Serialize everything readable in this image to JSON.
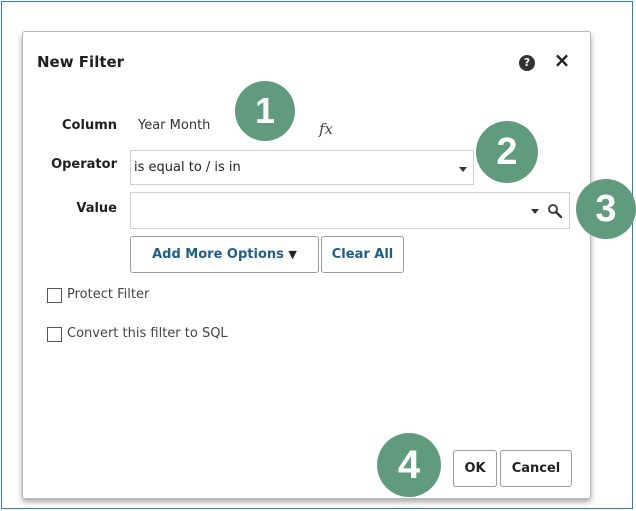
{
  "dialog": {
    "title": "New Filter",
    "help_icon": "question-circle-icon",
    "help_glyph": "?",
    "close_icon": "close-icon",
    "close_glyph": "×"
  },
  "form": {
    "column_label": "Column",
    "column_value": "Year Month",
    "fx_label": "fx",
    "operator_label": "Operator",
    "operator_value": "is equal to / is in",
    "value_label": "Value",
    "value_input": ""
  },
  "actions": {
    "add_more_options": "Add More Options",
    "add_more_caret": "▼",
    "clear_all": "Clear All"
  },
  "options": [
    {
      "label": "Protect Filter",
      "checked": false
    },
    {
      "label": "Convert this filter to SQL",
      "checked": false
    }
  ],
  "footer": {
    "ok": "OK",
    "cancel": "Cancel"
  },
  "markers": [
    "1",
    "2",
    "3",
    "4"
  ],
  "colors": {
    "marker": "#5f9b7c",
    "frame": "#2f7fb5",
    "link_button_text": "#1f5f85"
  }
}
